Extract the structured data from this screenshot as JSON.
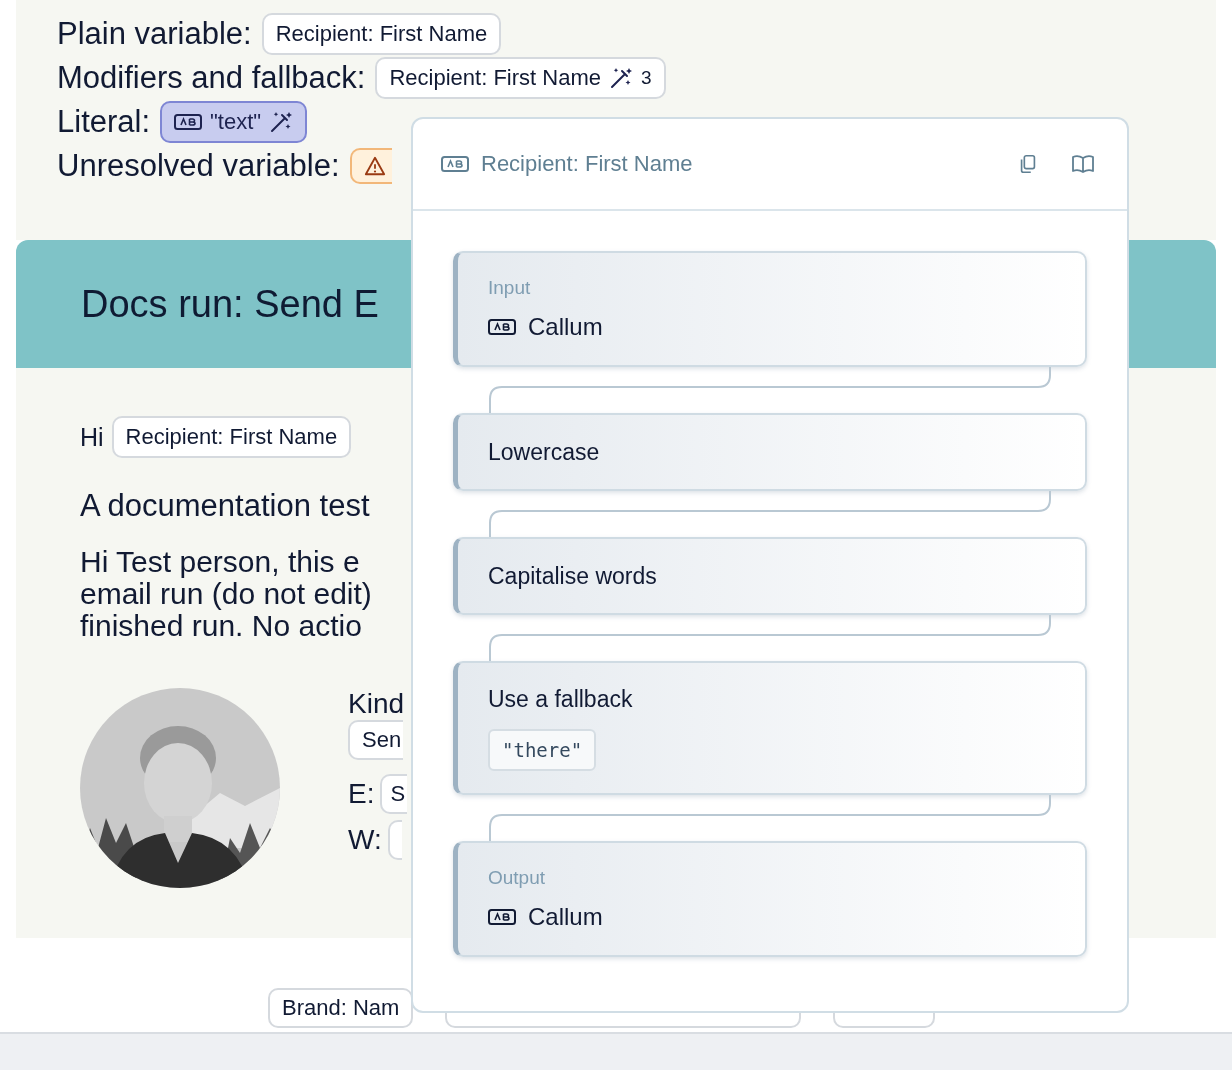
{
  "examples": [
    {
      "kind": "plain",
      "label": "Plain variable:",
      "chip": "Recipient: First Name"
    },
    {
      "kind": "modifiers",
      "label": "Modifiers and fallback:",
      "chip": "Recipient: First Name",
      "count": "3"
    },
    {
      "kind": "literal",
      "label": "Literal:",
      "chip": "\"text\""
    },
    {
      "kind": "unresolved",
      "label": "Unresolved variable:"
    }
  ],
  "email": {
    "title": "Docs run: Send E",
    "greeting": "Hi",
    "greeting_chip": "Recipient: First Name",
    "heading": "A documentation test",
    "body_lines": [
      "Hi Test person, this e",
      "email run (do not edit)",
      "finished run. No actio"
    ],
    "signature": {
      "kind_label": "Kind",
      "kind_chip": "Sen",
      "fields": [
        {
          "label": "E:",
          "chip": "S"
        },
        {
          "label": "W:"
        }
      ]
    }
  },
  "footer_chips": [
    {
      "kind": "text",
      "text": "Brand: Nam"
    },
    {
      "kind": "covered"
    },
    {
      "kind": "covered"
    }
  ],
  "popover": {
    "title": "Recipient: First Name",
    "steps": [
      {
        "kind": "input",
        "label": "Input",
        "value": "Callum"
      },
      {
        "kind": "modifier",
        "label": "Lowercase"
      },
      {
        "kind": "modifier",
        "label": "Capitalise words"
      },
      {
        "kind": "fallback",
        "label": "Use a fallback",
        "value": "\"there\""
      },
      {
        "kind": "output",
        "label": "Output",
        "value": "Callum"
      }
    ]
  }
}
